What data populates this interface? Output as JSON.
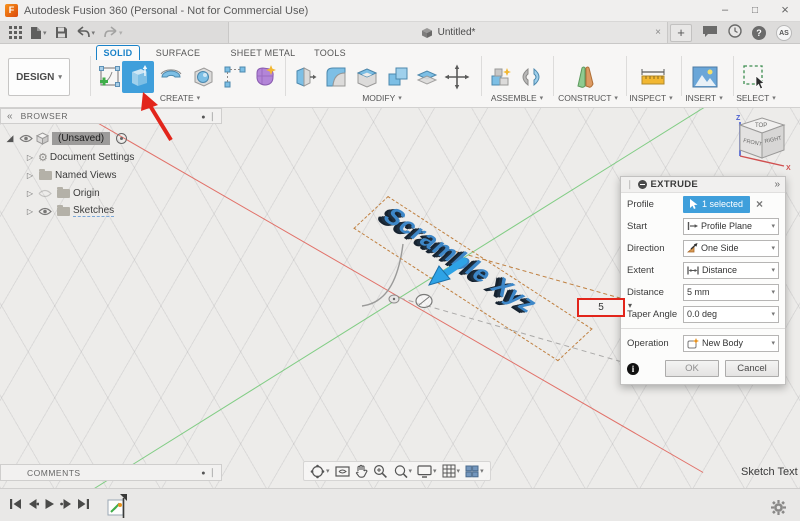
{
  "titlebar": {
    "title": "Autodesk Fusion 360 (Personal - Not for Commercial Use)"
  },
  "quickbar": {
    "tab_label": "Untitled*",
    "account_initials": "AS"
  },
  "ribbon": {
    "design_label": "DESIGN",
    "tabs": [
      {
        "label": "SOLID"
      },
      {
        "label": "SURFACE"
      },
      {
        "label": "SHEET METAL"
      },
      {
        "label": "TOOLS"
      }
    ],
    "groups": [
      {
        "label": "CREATE"
      },
      {
        "label": "MODIFY"
      },
      {
        "label": "ASSEMBLE"
      },
      {
        "label": "CONSTRUCT"
      },
      {
        "label": "INSPECT"
      },
      {
        "label": "INSERT"
      },
      {
        "label": "SELECT"
      }
    ]
  },
  "browser": {
    "title": "BROWSER",
    "root_label": "(Unsaved)",
    "items": [
      {
        "label": "Document Settings"
      },
      {
        "label": "Named Views"
      },
      {
        "label": "Origin"
      },
      {
        "label": "Sketches"
      }
    ]
  },
  "viewcube": {
    "top": "TOP",
    "front": "FRONT",
    "right": "RIGHT",
    "z": "Z",
    "x": "X"
  },
  "canvas": {
    "model_text": "Scramble Xyz",
    "hint_label": "Sketch Text",
    "float_value": "5"
  },
  "dialog": {
    "title": "EXTRUDE",
    "profile_label": "Profile",
    "profile_value": "1 selected",
    "start_label": "Start",
    "start_value": "Profile Plane",
    "direction_label": "Direction",
    "direction_value": "One Side",
    "extent_label": "Extent",
    "extent_value": "Distance",
    "distance_label": "Distance",
    "distance_value": "5 mm",
    "taper_label": "Taper Angle",
    "taper_value": "0.0 deg",
    "operation_label": "Operation",
    "operation_value": "New Body",
    "ok_label": "OK",
    "cancel_label": "Cancel"
  },
  "comments": {
    "title": "COMMENTS"
  },
  "colors": {
    "accent_blue": "#3F9FDB",
    "annotation_red": "#E2251B",
    "tab_blue": "#1A82C8"
  }
}
